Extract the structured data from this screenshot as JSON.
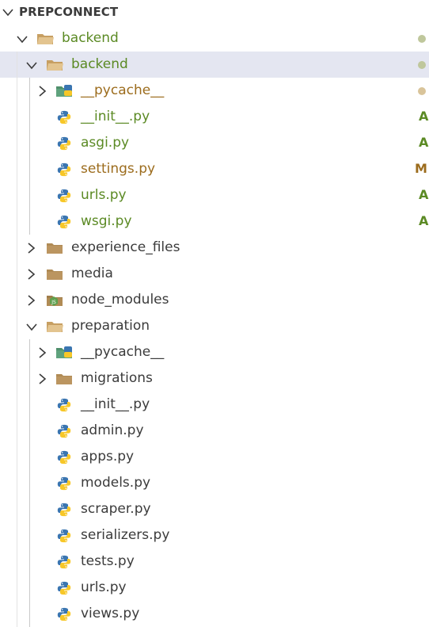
{
  "explorer": {
    "title": "PREPCONNECT",
    "items": [
      {
        "label": "backend",
        "status": "dot"
      },
      {
        "label": "backend",
        "status": "dot"
      },
      {
        "label": "__pycache__",
        "status": "dot"
      },
      {
        "label": "__init__.py",
        "status": "A"
      },
      {
        "label": "asgi.py",
        "status": "A"
      },
      {
        "label": "settings.py",
        "status": "M"
      },
      {
        "label": "urls.py",
        "status": "A"
      },
      {
        "label": "wsgi.py",
        "status": "A"
      },
      {
        "label": "experience_files"
      },
      {
        "label": "media"
      },
      {
        "label": "node_modules"
      },
      {
        "label": "preparation"
      },
      {
        "label": "__pycache__"
      },
      {
        "label": "migrations"
      },
      {
        "label": "__init__.py"
      },
      {
        "label": "admin.py"
      },
      {
        "label": "apps.py"
      },
      {
        "label": "models.py"
      },
      {
        "label": "scraper.py"
      },
      {
        "label": "serializers.py"
      },
      {
        "label": "tests.py"
      },
      {
        "label": "urls.py"
      },
      {
        "label": "views.py"
      }
    ]
  },
  "colors": {
    "added": "#5b8a24",
    "modified": "#9c6c1d",
    "dot": "#bfc79c",
    "default_text": "#3b3b3b",
    "selected_row": "#e4e6f1"
  },
  "icons": {
    "chevron_down": "chevron-down-icon",
    "chevron_right": "chevron-right-icon",
    "folder": "folder-icon",
    "folder_open": "folder-open-icon",
    "python": "python-file-icon",
    "node": "node-modules-folder-icon",
    "pycache": "pycache-folder-icon"
  }
}
